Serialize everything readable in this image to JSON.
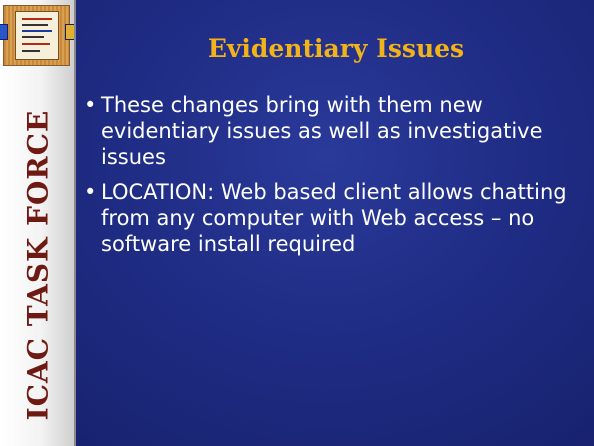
{
  "sidebar": {
    "vertical_title": "ICAC TASK FORCE"
  },
  "slide": {
    "title": "Evidentiary Issues",
    "bullets": [
      "These changes bring with them new evidentiary issues as well as investigative issues",
      "LOCATION: Web based client allows chatting from any computer with Web access – no software install required"
    ],
    "bullet_glyph": "•"
  },
  "colors": {
    "background": "#1f2c84",
    "title": "#f2b21a",
    "body_text": "#ffffff",
    "sidebar_text": "#6e1a12"
  },
  "icons": {
    "logo": "icac-logo-plaque"
  }
}
